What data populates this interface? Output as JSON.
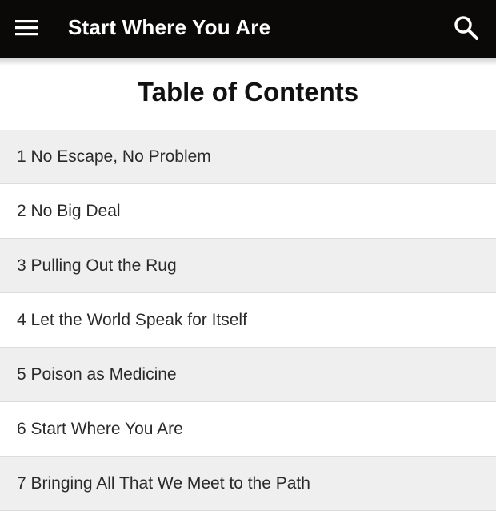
{
  "app_bar": {
    "title": "Start Where You Are",
    "menu_icon": "hamburger-menu-icon",
    "search_icon": "search-icon",
    "background": "#0b0908"
  },
  "content": {
    "heading": "Table of Contents",
    "chapters": [
      "1 No Escape, No Problem",
      "2 No Big Deal",
      "3 Pulling Out the Rug",
      "4 Let the World Speak for Itself",
      "5 Poison as Medicine",
      "6 Start Where You Are",
      "7 Bringing All That We Meet to the Path"
    ]
  }
}
